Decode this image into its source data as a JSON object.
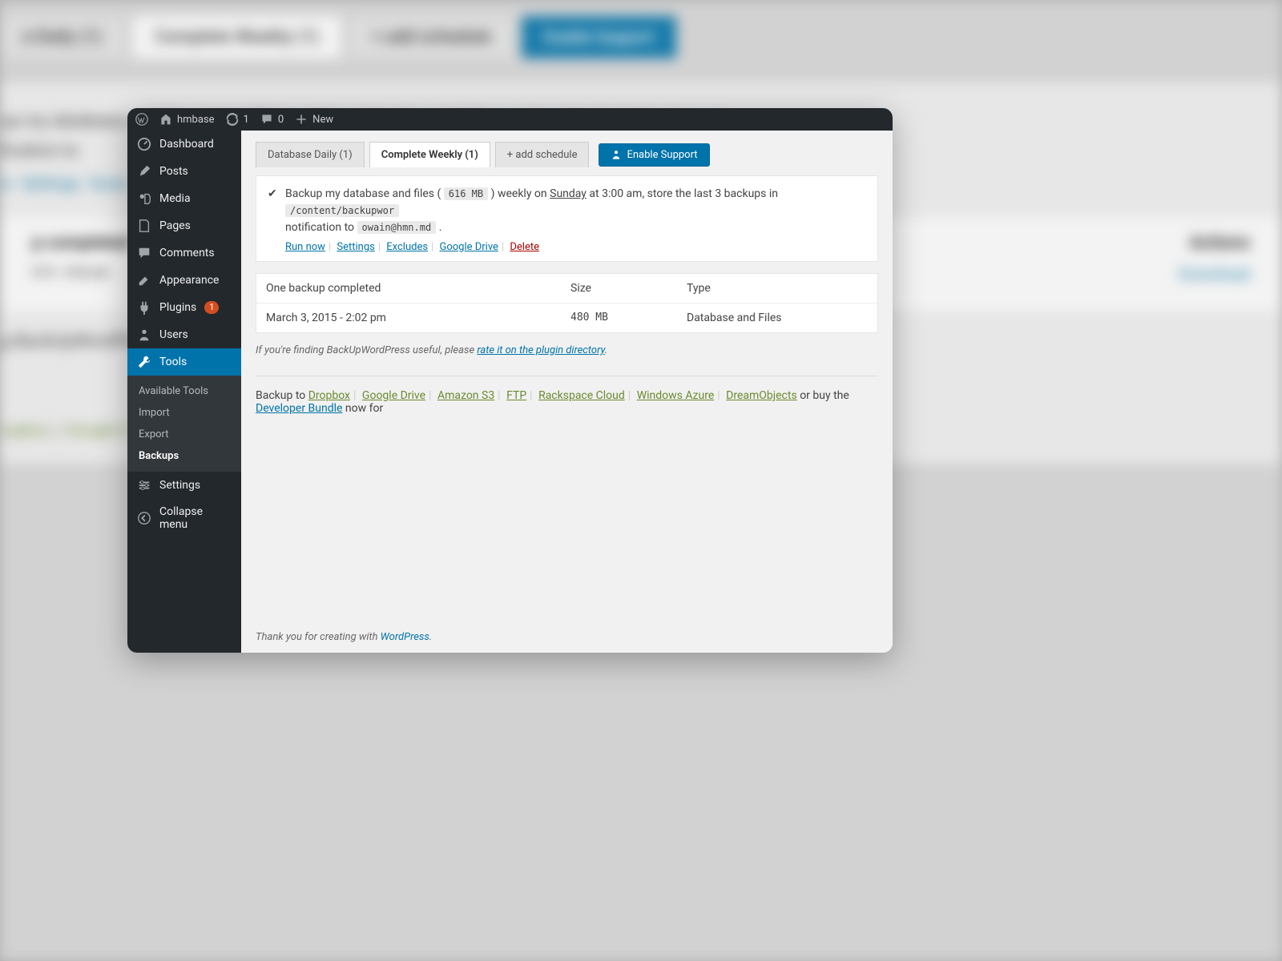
{
  "adminbar": {
    "site_name": "hmbase",
    "updates": "1",
    "comments": "0",
    "new": "New"
  },
  "sidebar": {
    "dashboard": "Dashboard",
    "posts": "Posts",
    "media": "Media",
    "pages": "Pages",
    "comments": "Comments",
    "appearance": "Appearance",
    "plugins": "Plugins",
    "plugins_badge": "1",
    "users": "Users",
    "tools": "Tools",
    "settings": "Settings",
    "collapse": "Collapse menu",
    "sub_available": "Available Tools",
    "sub_import": "Import",
    "sub_export": "Export",
    "sub_backups": "Backups"
  },
  "tabs": {
    "db_daily": "Database Daily (1)",
    "complete_weekly": "Complete Weekly (1)",
    "add_schedule": "+ add schedule",
    "enable_support": "Enable Support"
  },
  "panel": {
    "text_1": "Backup my database and files (",
    "size": "616 MB",
    "text_2": ") weekly on",
    "day": "Sunday",
    "text_3": "at 3:00 am, store the last 3 backups in",
    "path": "/content/backupwor",
    "text_4": "notification to",
    "email": "owain@hmn.md",
    "text_5": ".",
    "link_run": "Run now",
    "link_settings": "Settings",
    "link_excludes": "Excludes",
    "link_gdrive": "Google Drive",
    "link_delete": "Delete"
  },
  "table": {
    "head_completed": "One backup completed",
    "head_size": "Size",
    "head_type": "Type",
    "row_date": "March 3, 2015 - 2:02 pm",
    "row_size": "480 MB",
    "row_type": "Database and Files"
  },
  "hint": {
    "pre": "If you're finding BackUpWordPress useful, please ",
    "link": "rate it on the plugin directory",
    "post": "."
  },
  "backup_to": {
    "pre": "Backup to  ",
    "dropbox": "Dropbox",
    "gdrive": "Google Drive",
    "s3": "Amazon S3",
    "ftp": "FTP",
    "rackspace": "Rackspace Cloud",
    "azure": "Windows Azure",
    "dreamobjects": "DreamObjects",
    "or_buy": "   or buy the ",
    "dev_bundle": "Developer Bundle",
    "now_for": " now for"
  },
  "footer": {
    "pre": "Thank you for creating with ",
    "wp": "WordPress",
    "post": "."
  },
  "bg": {
    "tab1": "e Daily (1)",
    "tab2": "Complete Weekly (1)",
    "tab3": "+ add schedule",
    "btn": "Enable Support",
    "th_completed": "p completed",
    "th_actions": "Actions",
    "dl": "Download",
    "links": "Google D"
  }
}
